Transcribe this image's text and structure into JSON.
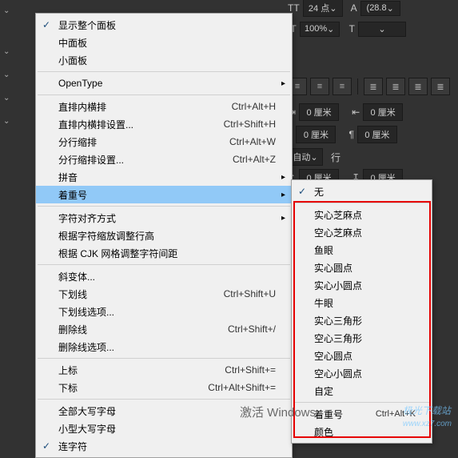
{
  "topbar": {
    "tt": "TT",
    "size": "24 点",
    "leading_icon": "A",
    "leading": "(28.8",
    "pct_icon": "IT",
    "pct": "100%",
    "t_icon": "T"
  },
  "align_row": {},
  "rows": {
    "r1_a": "0 厘米",
    "r1_b": "0 厘米",
    "r2_a": "自动",
    "r2_b": "行",
    "r3_a": "0 厘米",
    "r3_b": "0 厘米"
  },
  "menu": {
    "show_full": "显示整个面板",
    "medium": "中面板",
    "small": "小面板",
    "opentype": "OpenType",
    "tcy": "直排内横排",
    "tcy_sc": "Ctrl+Alt+H",
    "tcy_set": "直排内横排设置...",
    "tcy_set_sc": "Ctrl+Shift+H",
    "warichu": "分行缩排",
    "warichu_sc": "Ctrl+Alt+W",
    "warichu_set": "分行缩排设置...",
    "warichu_set_sc": "Ctrl+Alt+Z",
    "ruby": "拼音",
    "emphasis": "着重号",
    "char_align": "字符对齐方式",
    "scale_line": "根据字符缩放调整行高",
    "cjk_grid": "根据 CJK 网格调整字符间距",
    "italic": "斜变体...",
    "underline": "下划线",
    "underline_sc": "Ctrl+Shift+U",
    "underline_opt": "下划线选项...",
    "strike": "删除线",
    "strike_sc": "Ctrl+Shift+/",
    "strike_opt": "删除线选项...",
    "super": "上标",
    "super_sc": "Ctrl+Shift+=",
    "sub": "下标",
    "sub_sc": "Ctrl+Alt+Shift+=",
    "allcaps": "全部大写字母",
    "smallcaps": "小型大写字母",
    "ligature": "连字符"
  },
  "submenu": {
    "none": "无",
    "s1": "实心芝麻点",
    "s2": "空心芝麻点",
    "s3": "鱼眼",
    "s4": "实心圆点",
    "s5": "实心小圆点",
    "s6": "牛眼",
    "s7": "实心三角形",
    "s8": "空心三角形",
    "s9": "空心圆点",
    "s10": "空心小圆点",
    "s11": "自定",
    "s12": "着重号",
    "s12_sc": "Ctrl+Alt+K",
    "s13": "颜色"
  },
  "activate": "激活 Windows",
  "watermark": "极光下载站",
  "watermark_url": "www.xz7.com"
}
